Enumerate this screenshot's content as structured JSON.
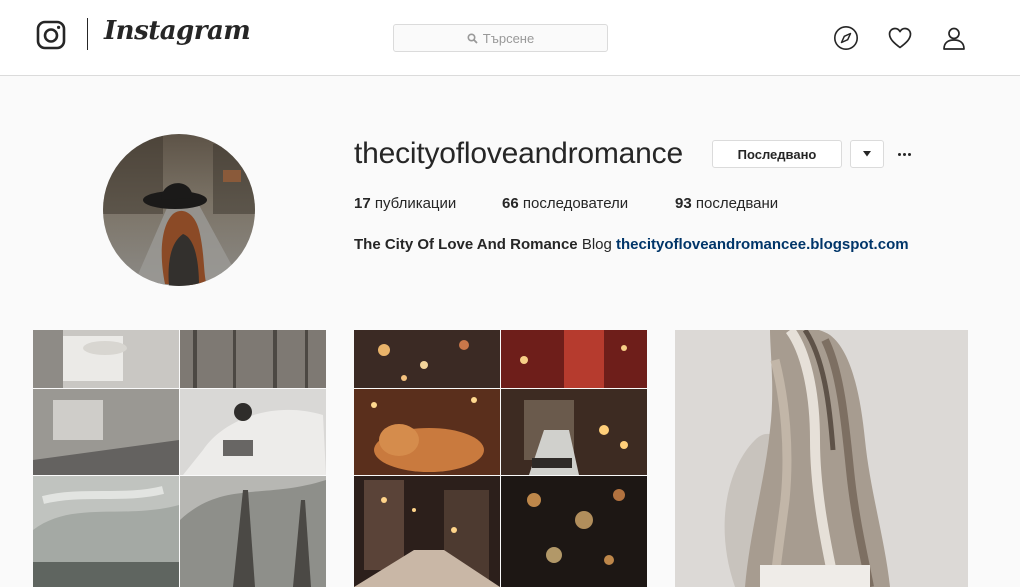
{
  "header": {
    "logo_icon": "instagram-camera-icon",
    "wordmark": "Instagram",
    "search_placeholder": "Търсене",
    "nav": [
      {
        "icon": "compass-icon"
      },
      {
        "icon": "heart-icon"
      },
      {
        "icon": "user-icon"
      }
    ]
  },
  "profile": {
    "username": "thecityofloveandromance",
    "follow_button": "Последвано",
    "stats": {
      "posts_count": "17",
      "posts_label": "публикации",
      "followers_count": "66",
      "followers_label": "последователи",
      "following_count": "93",
      "following_label": "последвани"
    },
    "bio": {
      "full_name": "The City Of Love And Romance",
      "text": "Blog",
      "link": "thecityofloveandromancee.blogspot.com"
    }
  },
  "posts": [
    {
      "description_icon": "photo-collage-icon"
    },
    {
      "description_icon": "photo-collage-icon"
    },
    {
      "description_icon": "photo-icon"
    }
  ],
  "colors": {
    "page_bg": "#fafafa",
    "border": "#dbdbdb",
    "text": "#262626",
    "link": "#003569"
  }
}
